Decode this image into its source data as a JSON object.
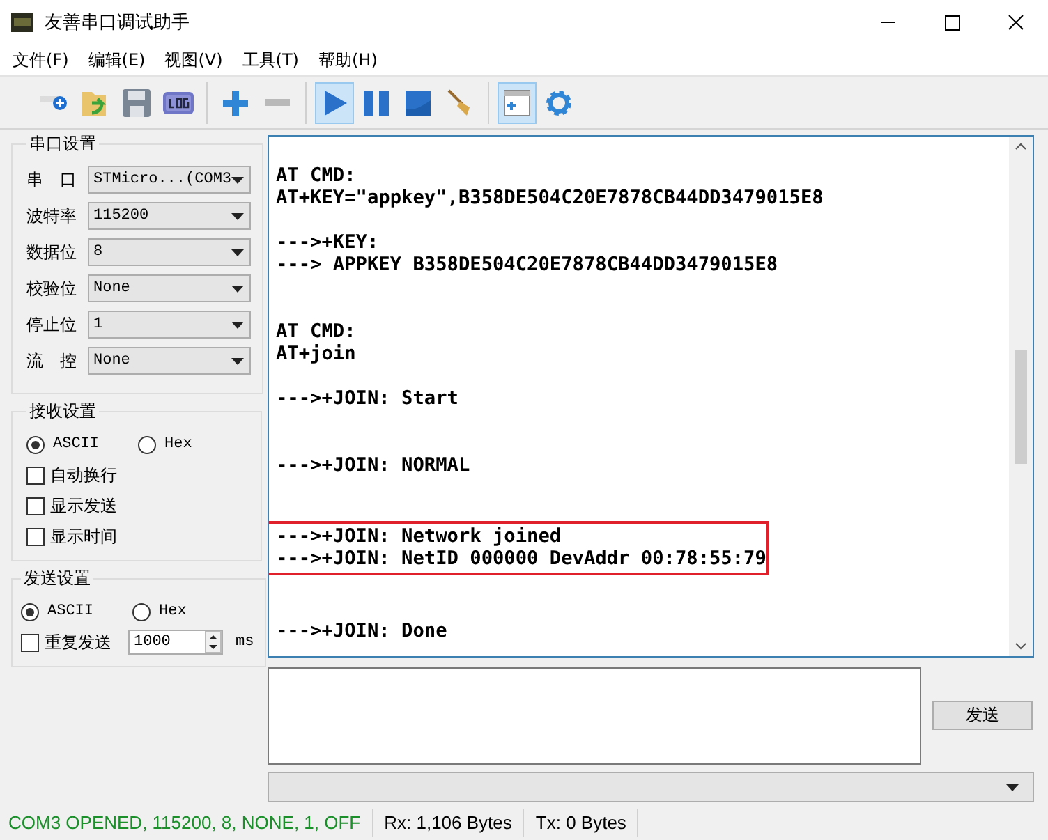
{
  "window": {
    "title": "友善串口调试助手"
  },
  "menu": [
    {
      "label": "文件(F)"
    },
    {
      "label": "编辑(E)"
    },
    {
      "label": "视图(V)"
    },
    {
      "label": "工具(T)"
    },
    {
      "label": "帮助(H)"
    }
  ],
  "toolbar": {
    "groups": [
      {
        "buttons": [
          {
            "kind": "new",
            "pressed": false
          },
          {
            "kind": "open",
            "pressed": false
          },
          {
            "kind": "save",
            "pressed": false
          },
          {
            "kind": "log",
            "pressed": false
          }
        ]
      },
      {
        "buttons": [
          {
            "kind": "add",
            "pressed": false
          },
          {
            "kind": "remove",
            "pressed": false
          }
        ]
      },
      {
        "buttons": [
          {
            "kind": "play",
            "pressed": true
          },
          {
            "kind": "pause",
            "pressed": false
          },
          {
            "kind": "stop",
            "pressed": false
          },
          {
            "kind": "broom",
            "pressed": false
          }
        ]
      },
      {
        "buttons": [
          {
            "kind": "panel",
            "pressed": true
          },
          {
            "kind": "gear",
            "pressed": false
          }
        ]
      }
    ]
  },
  "serial_settings": {
    "title": "串口设置",
    "rows": [
      {
        "label": "串　口",
        "value": "STMicro...(COM3"
      },
      {
        "label": "波特率",
        "value": "115200"
      },
      {
        "label": "数据位",
        "value": "8"
      },
      {
        "label": "校验位",
        "value": "None"
      },
      {
        "label": "停止位",
        "value": "1"
      },
      {
        "label": "流　控",
        "value": "None"
      }
    ]
  },
  "receive_settings": {
    "title": "接收设置",
    "radios": [
      {
        "label": "ASCII",
        "selected": true
      },
      {
        "label": "Hex",
        "selected": false
      }
    ],
    "checkboxes": [
      {
        "label": "自动换行",
        "checked": false
      },
      {
        "label": "显示发送",
        "checked": false
      },
      {
        "label": "显示时间",
        "checked": false
      }
    ]
  },
  "send_settings": {
    "title": "发送设置",
    "radios": [
      {
        "label": "ASCII",
        "selected": true
      },
      {
        "label": "Hex",
        "selected": false
      }
    ],
    "repeat": {
      "label": "重复发送",
      "checked": false,
      "value": "1000",
      "unit": "ms"
    }
  },
  "output": {
    "lines": [
      {
        "kind": "blank"
      },
      {
        "kind": "line",
        "text": "AT CMD:"
      },
      {
        "kind": "line",
        "text": "AT+KEY=\"appkey\",B358DE504C20E7878CB44DD3479015E8"
      },
      {
        "kind": "blank"
      },
      {
        "kind": "line",
        "text": "--->+KEY:"
      },
      {
        "kind": "line",
        "text": "---> APPKEY B358DE504C20E7878CB44DD3479015E8"
      },
      {
        "kind": "blank"
      },
      {
        "kind": "blank"
      },
      {
        "kind": "line",
        "text": "AT CMD:"
      },
      {
        "kind": "line",
        "text": "AT+join"
      },
      {
        "kind": "blank"
      },
      {
        "kind": "line",
        "text": "--->+JOIN: Start"
      },
      {
        "kind": "blank"
      },
      {
        "kind": "blank"
      },
      {
        "kind": "line",
        "text": "--->+JOIN: NORMAL"
      },
      {
        "kind": "blank"
      },
      {
        "kind": "blank"
      },
      {
        "kind": "highlight",
        "lines": [
          "--->+JOIN: Network joined",
          "--->+JOIN: NetID 000000 DevAddr 00:78:55:79"
        ]
      },
      {
        "kind": "blank"
      },
      {
        "kind": "blank"
      },
      {
        "kind": "line",
        "text": "--->+JOIN: Done"
      }
    ]
  },
  "send": {
    "button": "发送"
  },
  "status_bar": {
    "connection": "COM3 OPENED, 115200, 8, NONE, 1, OFF",
    "rx": "Rx: 1,106 Bytes",
    "tx": "Tx: 0 Bytes"
  }
}
